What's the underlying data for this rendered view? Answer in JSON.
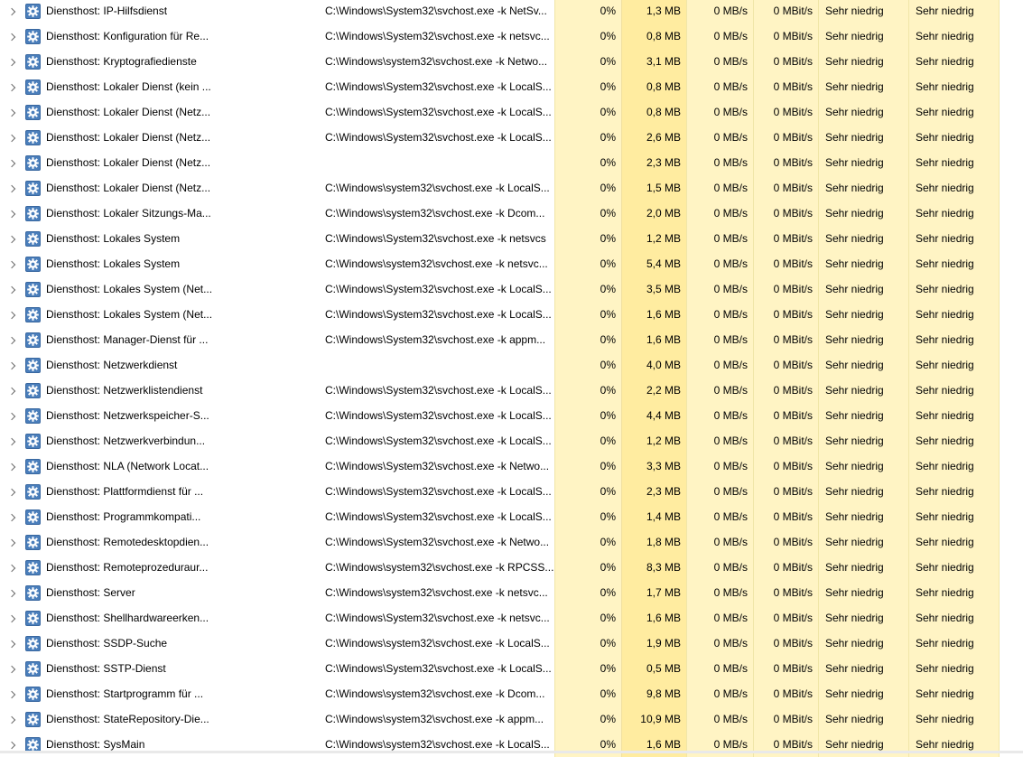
{
  "colors": {
    "heat_light": "#fff4c4",
    "heat_medium": "#ffeca0",
    "gear_blue": "#4a7ebb"
  },
  "icons": {
    "expand": "chevron-right-icon",
    "service": "gear-icon"
  },
  "rows": [
    {
      "name": "Diensthost: IP-Hilfsdienst",
      "cmd": "C:\\Windows\\System32\\svchost.exe -k NetSv...",
      "cpu": "0%",
      "mem": "1,3 MB",
      "disk": "0 MB/s",
      "net": "0 MBit/s",
      "power": "Sehr niedrig",
      "trend": "Sehr niedrig"
    },
    {
      "name": "Diensthost: Konfiguration für Re...",
      "cmd": "C:\\Windows\\System32\\svchost.exe -k netsvc...",
      "cpu": "0%",
      "mem": "0,8 MB",
      "disk": "0 MB/s",
      "net": "0 MBit/s",
      "power": "Sehr niedrig",
      "trend": "Sehr niedrig"
    },
    {
      "name": "Diensthost: Kryptografiedienste",
      "cmd": "C:\\Windows\\system32\\svchost.exe -k Netwo...",
      "cpu": "0%",
      "mem": "3,1 MB",
      "disk": "0 MB/s",
      "net": "0 MBit/s",
      "power": "Sehr niedrig",
      "trend": "Sehr niedrig"
    },
    {
      "name": "Diensthost: Lokaler Dienst (kein ...",
      "cmd": "C:\\Windows\\System32\\svchost.exe -k LocalS...",
      "cpu": "0%",
      "mem": "0,8 MB",
      "disk": "0 MB/s",
      "net": "0 MBit/s",
      "power": "Sehr niedrig",
      "trend": "Sehr niedrig"
    },
    {
      "name": "Diensthost: Lokaler Dienst (Netz...",
      "cmd": "C:\\Windows\\System32\\svchost.exe -k LocalS...",
      "cpu": "0%",
      "mem": "0,8 MB",
      "disk": "0 MB/s",
      "net": "0 MBit/s",
      "power": "Sehr niedrig",
      "trend": "Sehr niedrig"
    },
    {
      "name": "Diensthost: Lokaler Dienst (Netz...",
      "cmd": "C:\\Windows\\System32\\svchost.exe -k LocalS...",
      "cpu": "0%",
      "mem": "2,6 MB",
      "disk": "0 MB/s",
      "net": "0 MBit/s",
      "power": "Sehr niedrig",
      "trend": "Sehr niedrig"
    },
    {
      "name": "Diensthost: Lokaler Dienst (Netz...",
      "cmd": "",
      "cpu": "0%",
      "mem": "2,3 MB",
      "disk": "0 MB/s",
      "net": "0 MBit/s",
      "power": "Sehr niedrig",
      "trend": "Sehr niedrig"
    },
    {
      "name": "Diensthost: Lokaler Dienst (Netz...",
      "cmd": "C:\\Windows\\system32\\svchost.exe -k LocalS...",
      "cpu": "0%",
      "mem": "1,5 MB",
      "disk": "0 MB/s",
      "net": "0 MBit/s",
      "power": "Sehr niedrig",
      "trend": "Sehr niedrig"
    },
    {
      "name": "Diensthost: Lokaler Sitzungs-Ma...",
      "cmd": "C:\\Windows\\system32\\svchost.exe -k Dcom...",
      "cpu": "0%",
      "mem": "2,0 MB",
      "disk": "0 MB/s",
      "net": "0 MBit/s",
      "power": "Sehr niedrig",
      "trend": "Sehr niedrig"
    },
    {
      "name": "Diensthost: Lokales System",
      "cmd": "C:\\Windows\\System32\\svchost.exe -k netsvcs",
      "cpu": "0%",
      "mem": "1,2 MB",
      "disk": "0 MB/s",
      "net": "0 MBit/s",
      "power": "Sehr niedrig",
      "trend": "Sehr niedrig"
    },
    {
      "name": "Diensthost: Lokales System",
      "cmd": "C:\\Windows\\system32\\svchost.exe -k netsvc...",
      "cpu": "0%",
      "mem": "5,4 MB",
      "disk": "0 MB/s",
      "net": "0 MBit/s",
      "power": "Sehr niedrig",
      "trend": "Sehr niedrig"
    },
    {
      "name": "Diensthost: Lokales System (Net...",
      "cmd": "C:\\Windows\\System32\\svchost.exe -k LocalS...",
      "cpu": "0%",
      "mem": "3,5 MB",
      "disk": "0 MB/s",
      "net": "0 MBit/s",
      "power": "Sehr niedrig",
      "trend": "Sehr niedrig"
    },
    {
      "name": "Diensthost: Lokales System (Net...",
      "cmd": "C:\\Windows\\System32\\svchost.exe -k LocalS...",
      "cpu": "0%",
      "mem": "1,6 MB",
      "disk": "0 MB/s",
      "net": "0 MBit/s",
      "power": "Sehr niedrig",
      "trend": "Sehr niedrig"
    },
    {
      "name": "Diensthost: Manager-Dienst für ...",
      "cmd": "C:\\Windows\\System32\\svchost.exe -k appm...",
      "cpu": "0%",
      "mem": "1,6 MB",
      "disk": "0 MB/s",
      "net": "0 MBit/s",
      "power": "Sehr niedrig",
      "trend": "Sehr niedrig"
    },
    {
      "name": "Diensthost: Netzwerkdienst",
      "cmd": "",
      "cpu": "0%",
      "mem": "4,0 MB",
      "disk": "0 MB/s",
      "net": "0 MBit/s",
      "power": "Sehr niedrig",
      "trend": "Sehr niedrig"
    },
    {
      "name": "Diensthost: Netzwerklistendienst",
      "cmd": "C:\\Windows\\System32\\svchost.exe -k LocalS...",
      "cpu": "0%",
      "mem": "2,2 MB",
      "disk": "0 MB/s",
      "net": "0 MBit/s",
      "power": "Sehr niedrig",
      "trend": "Sehr niedrig"
    },
    {
      "name": "Diensthost: Netzwerkspeicher-S...",
      "cmd": "C:\\Windows\\System32\\svchost.exe -k LocalS...",
      "cpu": "0%",
      "mem": "4,4 MB",
      "disk": "0 MB/s",
      "net": "0 MBit/s",
      "power": "Sehr niedrig",
      "trend": "Sehr niedrig"
    },
    {
      "name": "Diensthost: Netzwerkverbindun...",
      "cmd": "C:\\Windows\\System32\\svchost.exe -k LocalS...",
      "cpu": "0%",
      "mem": "1,2 MB",
      "disk": "0 MB/s",
      "net": "0 MBit/s",
      "power": "Sehr niedrig",
      "trend": "Sehr niedrig"
    },
    {
      "name": "Diensthost: NLA (Network Locat...",
      "cmd": "C:\\Windows\\System32\\svchost.exe -k Netwo...",
      "cpu": "0%",
      "mem": "3,3 MB",
      "disk": "0 MB/s",
      "net": "0 MBit/s",
      "power": "Sehr niedrig",
      "trend": "Sehr niedrig"
    },
    {
      "name": "Diensthost: Plattformdienst für ...",
      "cmd": "C:\\Windows\\System32\\svchost.exe -k LocalS...",
      "cpu": "0%",
      "mem": "2,3 MB",
      "disk": "0 MB/s",
      "net": "0 MBit/s",
      "power": "Sehr niedrig",
      "trend": "Sehr niedrig"
    },
    {
      "name": "Diensthost: Programmkompati...",
      "cmd": "C:\\Windows\\System32\\svchost.exe -k LocalS...",
      "cpu": "0%",
      "mem": "1,4 MB",
      "disk": "0 MB/s",
      "net": "0 MBit/s",
      "power": "Sehr niedrig",
      "trend": "Sehr niedrig"
    },
    {
      "name": "Diensthost: Remotedesktopdien...",
      "cmd": "C:\\Windows\\System32\\svchost.exe -k Netwo...",
      "cpu": "0%",
      "mem": "1,8 MB",
      "disk": "0 MB/s",
      "net": "0 MBit/s",
      "power": "Sehr niedrig",
      "trend": "Sehr niedrig"
    },
    {
      "name": "Diensthost: Remoteprozeduraur...",
      "cmd": "C:\\Windows\\system32\\svchost.exe -k RPCSS...",
      "cpu": "0%",
      "mem": "8,3 MB",
      "disk": "0 MB/s",
      "net": "0 MBit/s",
      "power": "Sehr niedrig",
      "trend": "Sehr niedrig"
    },
    {
      "name": "Diensthost: Server",
      "cmd": "C:\\Windows\\system32\\svchost.exe -k netsvc...",
      "cpu": "0%",
      "mem": "1,7 MB",
      "disk": "0 MB/s",
      "net": "0 MBit/s",
      "power": "Sehr niedrig",
      "trend": "Sehr niedrig"
    },
    {
      "name": "Diensthost: Shellhardwareerken...",
      "cmd": "C:\\Windows\\System32\\svchost.exe -k netsvc...",
      "cpu": "0%",
      "mem": "1,6 MB",
      "disk": "0 MB/s",
      "net": "0 MBit/s",
      "power": "Sehr niedrig",
      "trend": "Sehr niedrig"
    },
    {
      "name": "Diensthost: SSDP-Suche",
      "cmd": "C:\\Windows\\system32\\svchost.exe -k LocalS...",
      "cpu": "0%",
      "mem": "1,9 MB",
      "disk": "0 MB/s",
      "net": "0 MBit/s",
      "power": "Sehr niedrig",
      "trend": "Sehr niedrig"
    },
    {
      "name": "Diensthost: SSTP-Dienst",
      "cmd": "C:\\Windows\\System32\\svchost.exe -k LocalS...",
      "cpu": "0%",
      "mem": "0,5 MB",
      "disk": "0 MB/s",
      "net": "0 MBit/s",
      "power": "Sehr niedrig",
      "trend": "Sehr niedrig"
    },
    {
      "name": "Diensthost: Startprogramm für ...",
      "cmd": "C:\\Windows\\system32\\svchost.exe -k Dcom...",
      "cpu": "0%",
      "mem": "9,8 MB",
      "disk": "0 MB/s",
      "net": "0 MBit/s",
      "power": "Sehr niedrig",
      "trend": "Sehr niedrig"
    },
    {
      "name": "Diensthost: StateRepository-Die...",
      "cmd": "C:\\Windows\\system32\\svchost.exe -k appm...",
      "cpu": "0%",
      "mem": "10,9 MB",
      "disk": "0 MB/s",
      "net": "0 MBit/s",
      "power": "Sehr niedrig",
      "trend": "Sehr niedrig"
    },
    {
      "name": "Diensthost: SysMain",
      "cmd": "C:\\Windows\\system32\\svchost.exe -k LocalS...",
      "cpu": "0%",
      "mem": "1,6 MB",
      "disk": "0 MB/s",
      "net": "0 MBit/s",
      "power": "Sehr niedrig",
      "trend": "Sehr niedrig"
    }
  ]
}
